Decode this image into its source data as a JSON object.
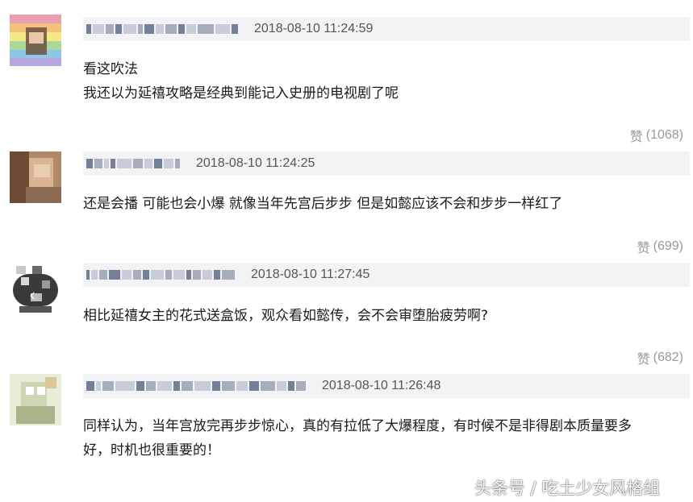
{
  "comments": [
    {
      "timestamp": "2018-08-10 11:24:59",
      "lines": [
        "看这吹法",
        "我还以为延禧攻略是经典到能记入史册的电视剧了呢"
      ],
      "like_label": "赞",
      "like_count": "(1068)"
    },
    {
      "timestamp": "2018-08-10 11:24:25",
      "lines": [
        "还是会播 可能也会小爆 就像当年先宫后步步 但是如懿应该不会和步步一样红了"
      ],
      "like_label": "赞",
      "like_count": "(699)"
    },
    {
      "timestamp": "2018-08-10 11:27:45",
      "lines": [
        "相比延禧女主的花式送盒饭，观众看如懿传，会不会审堕胎疲劳啊?"
      ],
      "like_label": "赞",
      "like_count": "(682)"
    },
    {
      "timestamp": "2018-08-10 11:26:48",
      "lines": [
        "同样认为，当年宫放完再步步惊心，真的有拉低了大爆程度，有时候不是非得剧本质量要多",
        "好，时机也很重要的！"
      ],
      "like_label": "",
      "like_count": ""
    }
  ],
  "watermark": "头条号 / 吃土少女风格组",
  "colors": {
    "header_bar": "#f2f3f5",
    "muted_text": "#999999",
    "body_text": "#1a1a1a"
  },
  "icons": {
    "back": "chevron-left-icon"
  }
}
